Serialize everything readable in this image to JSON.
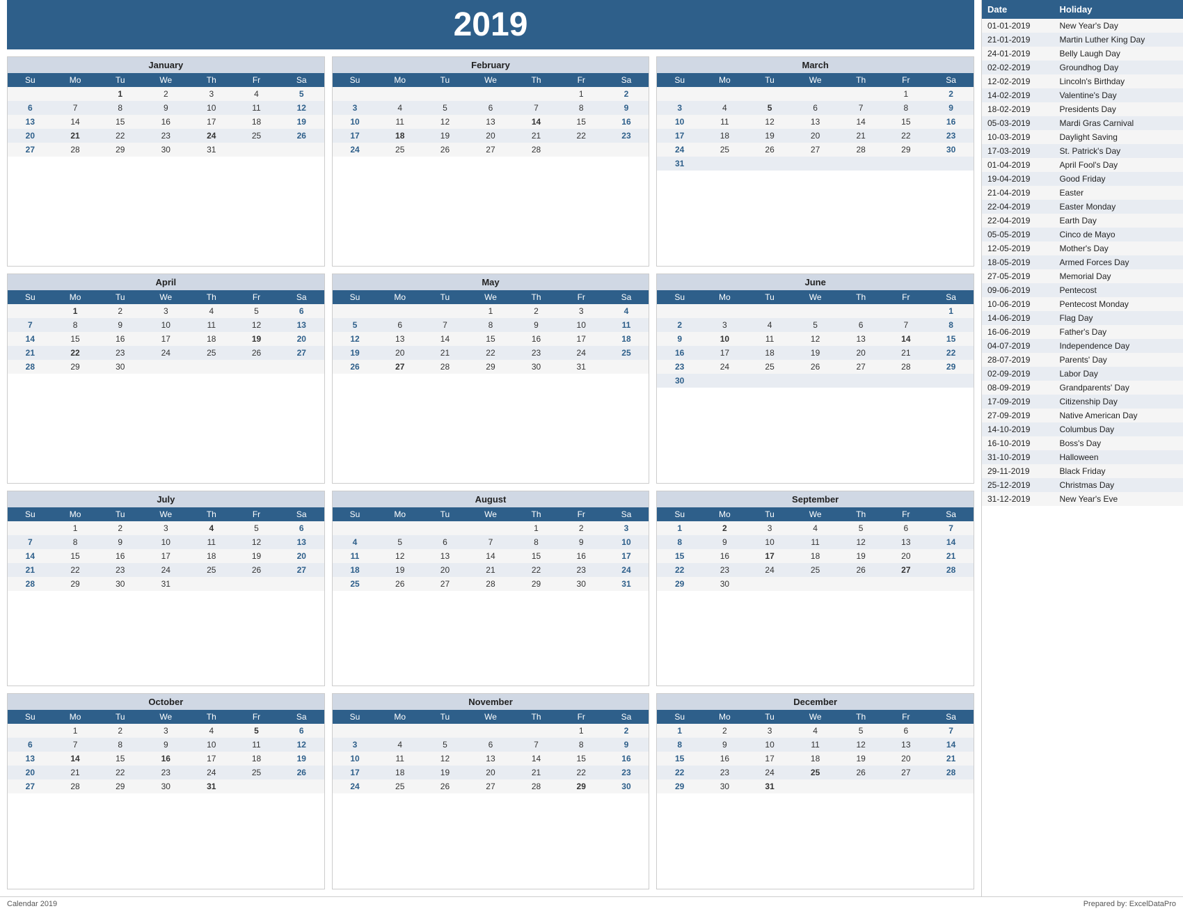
{
  "year": "2019",
  "footer_left": "Calendar 2019",
  "footer_right": "Prepared by: ExcelDataPro",
  "months": [
    {
      "name": "January",
      "days": [
        [
          "",
          "",
          "1",
          "2",
          "3",
          "4",
          "5"
        ],
        [
          "6",
          "7",
          "8",
          "9",
          "10",
          "11",
          "12"
        ],
        [
          "13",
          "14",
          "15",
          "16",
          "17",
          "18",
          "19"
        ],
        [
          "20",
          "21",
          "22",
          "23",
          "24",
          "25",
          "26"
        ],
        [
          "27",
          "28",
          "29",
          "30",
          "31",
          "",
          ""
        ]
      ],
      "bold": [
        "5",
        "12",
        "19",
        "26",
        "1",
        "24",
        "21"
      ]
    },
    {
      "name": "February",
      "days": [
        [
          "",
          "",
          "",
          "",
          "",
          "1",
          "2"
        ],
        [
          "3",
          "4",
          "5",
          "6",
          "7",
          "8",
          "9"
        ],
        [
          "10",
          "11",
          "12",
          "13",
          "14",
          "15",
          "16"
        ],
        [
          "17",
          "18",
          "19",
          "20",
          "21",
          "22",
          "23"
        ],
        [
          "24",
          "25",
          "26",
          "27",
          "28",
          "",
          ""
        ]
      ],
      "bold": [
        "2",
        "9",
        "16",
        "23",
        "18",
        "14"
      ]
    },
    {
      "name": "March",
      "days": [
        [
          "",
          "",
          "",
          "",
          "",
          "1",
          "2"
        ],
        [
          "3",
          "4",
          "5",
          "6",
          "7",
          "8",
          "9"
        ],
        [
          "10",
          "11",
          "12",
          "13",
          "14",
          "15",
          "16"
        ],
        [
          "17",
          "18",
          "19",
          "20",
          "21",
          "22",
          "23"
        ],
        [
          "24",
          "25",
          "26",
          "27",
          "28",
          "29",
          "30"
        ],
        [
          "31",
          "",
          "",
          "",
          "",
          "",
          ""
        ]
      ],
      "bold": [
        "2",
        "9",
        "16",
        "23",
        "30",
        "5",
        "10"
      ]
    },
    {
      "name": "April",
      "days": [
        [
          "",
          "1",
          "2",
          "3",
          "4",
          "5",
          "6"
        ],
        [
          "7",
          "8",
          "9",
          "10",
          "11",
          "12",
          "13"
        ],
        [
          "14",
          "15",
          "16",
          "17",
          "18",
          "19",
          "20"
        ],
        [
          "21",
          "22",
          "23",
          "24",
          "25",
          "26",
          "27"
        ],
        [
          "28",
          "29",
          "30",
          "",
          "",
          "",
          ""
        ]
      ],
      "bold": [
        "6",
        "13",
        "20",
        "27",
        "1",
        "19",
        "22"
      ]
    },
    {
      "name": "May",
      "days": [
        [
          "",
          "",
          "",
          "1",
          "2",
          "3",
          "4"
        ],
        [
          "5",
          "6",
          "7",
          "8",
          "9",
          "10",
          "11"
        ],
        [
          "12",
          "13",
          "14",
          "15",
          "16",
          "17",
          "18"
        ],
        [
          "19",
          "20",
          "21",
          "22",
          "23",
          "24",
          "25"
        ],
        [
          "26",
          "27",
          "28",
          "29",
          "30",
          "31",
          ""
        ]
      ],
      "bold": [
        "4",
        "11",
        "18",
        "25",
        "27"
      ]
    },
    {
      "name": "June",
      "days": [
        [
          "",
          "",
          "",
          "",
          "",
          "",
          "1"
        ],
        [
          "2",
          "3",
          "4",
          "5",
          "6",
          "7",
          "8"
        ],
        [
          "9",
          "10",
          "11",
          "12",
          "13",
          "14",
          "15"
        ],
        [
          "16",
          "17",
          "18",
          "19",
          "20",
          "21",
          "22"
        ],
        [
          "23",
          "24",
          "25",
          "26",
          "27",
          "28",
          "29"
        ],
        [
          "30",
          "",
          "",
          "",
          "",
          "",
          ""
        ]
      ],
      "bold": [
        "1",
        "8",
        "15",
        "22",
        "29",
        "10",
        "14"
      ]
    },
    {
      "name": "July",
      "days": [
        [
          "",
          "1",
          "2",
          "3",
          "4",
          "5",
          "6"
        ],
        [
          "7",
          "8",
          "9",
          "10",
          "11",
          "12",
          "13"
        ],
        [
          "14",
          "15",
          "16",
          "17",
          "18",
          "19",
          "20"
        ],
        [
          "21",
          "22",
          "23",
          "24",
          "25",
          "26",
          "27"
        ],
        [
          "28",
          "29",
          "30",
          "31",
          "",
          "",
          ""
        ]
      ],
      "bold": [
        "6",
        "13",
        "20",
        "27",
        "4"
      ]
    },
    {
      "name": "August",
      "days": [
        [
          "",
          "",
          "",
          "",
          "1",
          "2",
          "3"
        ],
        [
          "4",
          "5",
          "6",
          "7",
          "8",
          "9",
          "10"
        ],
        [
          "11",
          "12",
          "13",
          "14",
          "15",
          "16",
          "17"
        ],
        [
          "18",
          "19",
          "20",
          "21",
          "22",
          "23",
          "24"
        ],
        [
          "25",
          "26",
          "27",
          "28",
          "29",
          "30",
          "31"
        ]
      ],
      "bold": [
        "3",
        "10",
        "17",
        "24",
        "31"
      ]
    },
    {
      "name": "September",
      "days": [
        [
          "1",
          "2",
          "3",
          "4",
          "5",
          "6",
          "7"
        ],
        [
          "8",
          "9",
          "10",
          "11",
          "12",
          "13",
          "14"
        ],
        [
          "15",
          "16",
          "17",
          "18",
          "19",
          "20",
          "21"
        ],
        [
          "22",
          "23",
          "24",
          "25",
          "26",
          "27",
          "28"
        ],
        [
          "29",
          "30",
          "",
          "",
          "",
          "",
          ""
        ]
      ],
      "bold": [
        "7",
        "14",
        "21",
        "28",
        "1",
        "2",
        "17",
        "27"
      ]
    },
    {
      "name": "October",
      "days": [
        [
          "",
          "1",
          "2",
          "3",
          "4",
          "5",
          "6"
        ],
        [
          "6",
          "7",
          "8",
          "9",
          "10",
          "11",
          "12"
        ],
        [
          "13",
          "14",
          "15",
          "16",
          "17",
          "18",
          "19"
        ],
        [
          "20",
          "21",
          "22",
          "23",
          "24",
          "25",
          "26"
        ],
        [
          "27",
          "28",
          "29",
          "30",
          "31",
          "",
          ""
        ]
      ],
      "bold": [
        "5",
        "12",
        "19",
        "26",
        "14",
        "16",
        "31"
      ]
    },
    {
      "name": "November",
      "days": [
        [
          "",
          "",
          "",
          "",
          "",
          "1",
          "2"
        ],
        [
          "3",
          "4",
          "5",
          "6",
          "7",
          "8",
          "9"
        ],
        [
          "10",
          "11",
          "12",
          "13",
          "14",
          "15",
          "16"
        ],
        [
          "17",
          "18",
          "19",
          "20",
          "21",
          "22",
          "23"
        ],
        [
          "24",
          "25",
          "26",
          "27",
          "28",
          "29",
          "30"
        ]
      ],
      "bold": [
        "2",
        "9",
        "16",
        "23",
        "29",
        "30"
      ]
    },
    {
      "name": "December",
      "days": [
        [
          "1",
          "2",
          "3",
          "4",
          "5",
          "6",
          "7"
        ],
        [
          "8",
          "9",
          "10",
          "11",
          "12",
          "13",
          "14"
        ],
        [
          "15",
          "16",
          "17",
          "18",
          "19",
          "20",
          "21"
        ],
        [
          "22",
          "23",
          "24",
          "25",
          "26",
          "27",
          "28"
        ],
        [
          "29",
          "30",
          "31",
          "",
          "",
          "",
          ""
        ]
      ],
      "bold": [
        "7",
        "14",
        "21",
        "28",
        "1",
        "25",
        "31"
      ]
    }
  ],
  "day_headers": [
    "Su",
    "Mo",
    "Tu",
    "We",
    "Th",
    "Fr",
    "Sa"
  ],
  "holidays": [
    {
      "date": "01-01-2019",
      "name": "New Year's Day"
    },
    {
      "date": "21-01-2019",
      "name": "Martin Luther King Day"
    },
    {
      "date": "24-01-2019",
      "name": "Belly Laugh Day"
    },
    {
      "date": "02-02-2019",
      "name": "Groundhog Day"
    },
    {
      "date": "12-02-2019",
      "name": "Lincoln's Birthday"
    },
    {
      "date": "14-02-2019",
      "name": "Valentine's Day"
    },
    {
      "date": "18-02-2019",
      "name": "Presidents Day"
    },
    {
      "date": "05-03-2019",
      "name": "Mardi Gras Carnival"
    },
    {
      "date": "10-03-2019",
      "name": "Daylight Saving"
    },
    {
      "date": "17-03-2019",
      "name": "St. Patrick's Day"
    },
    {
      "date": "01-04-2019",
      "name": "April Fool's Day"
    },
    {
      "date": "19-04-2019",
      "name": "Good Friday"
    },
    {
      "date": "21-04-2019",
      "name": "Easter"
    },
    {
      "date": "22-04-2019",
      "name": "Easter Monday"
    },
    {
      "date": "22-04-2019",
      "name": "Earth Day"
    },
    {
      "date": "05-05-2019",
      "name": "Cinco de Mayo"
    },
    {
      "date": "12-05-2019",
      "name": "Mother's Day"
    },
    {
      "date": "18-05-2019",
      "name": "Armed Forces Day"
    },
    {
      "date": "27-05-2019",
      "name": "Memorial Day"
    },
    {
      "date": "09-06-2019",
      "name": "Pentecost"
    },
    {
      "date": "10-06-2019",
      "name": "Pentecost Monday"
    },
    {
      "date": "14-06-2019",
      "name": "Flag Day"
    },
    {
      "date": "16-06-2019",
      "name": "Father's Day"
    },
    {
      "date": "04-07-2019",
      "name": "Independence Day"
    },
    {
      "date": "28-07-2019",
      "name": "Parents' Day"
    },
    {
      "date": "02-09-2019",
      "name": "Labor Day"
    },
    {
      "date": "08-09-2019",
      "name": "Grandparents' Day"
    },
    {
      "date": "17-09-2019",
      "name": "Citizenship Day"
    },
    {
      "date": "27-09-2019",
      "name": "Native American Day"
    },
    {
      "date": "14-10-2019",
      "name": "Columbus Day"
    },
    {
      "date": "16-10-2019",
      "name": "Boss's Day"
    },
    {
      "date": "31-10-2019",
      "name": "Halloween"
    },
    {
      "date": "29-11-2019",
      "name": "Black Friday"
    },
    {
      "date": "25-12-2019",
      "name": "Christmas Day"
    },
    {
      "date": "31-12-2019",
      "name": "New Year's Eve"
    }
  ],
  "holiday_col_date": "Date",
  "holiday_col_name": "Holiday"
}
